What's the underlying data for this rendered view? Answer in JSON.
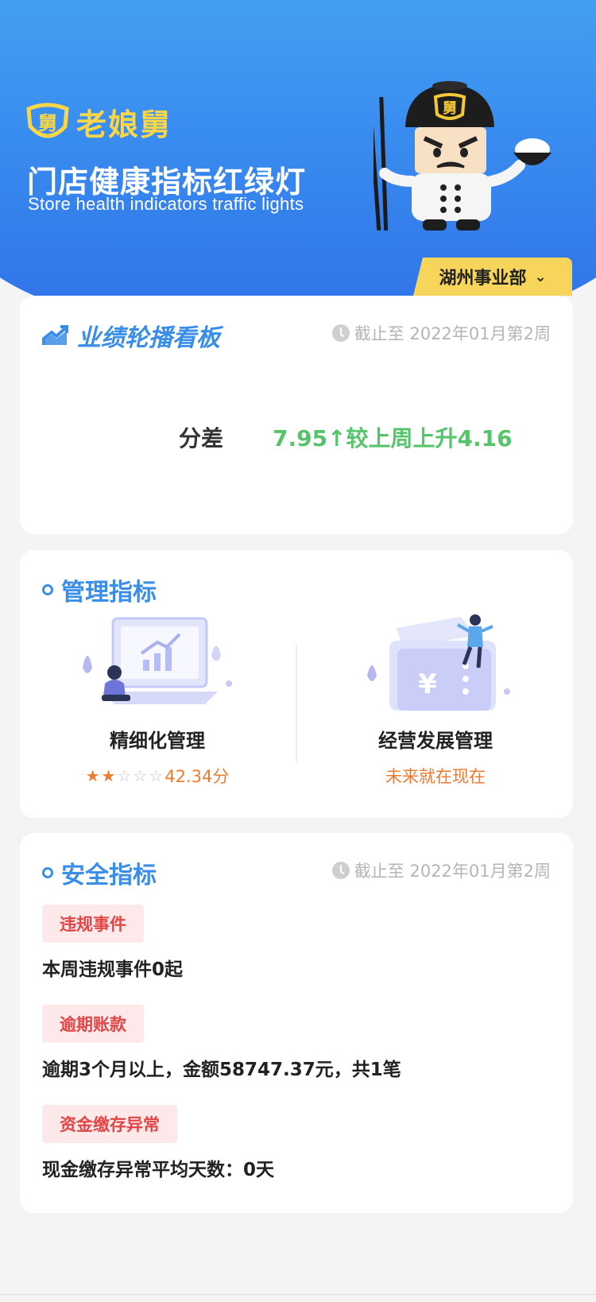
{
  "header": {
    "logo_text": "老娘舅",
    "logo_badge_text": "舅",
    "title": "门店健康指标红绿灯",
    "subtitle": "Store health indicators traffic lights",
    "department": "湖州事业部"
  },
  "performance": {
    "title": "业绩轮播看板",
    "deadline": "截止至 2022年01月第2周",
    "diff_label": "分差",
    "diff_value": "7.95↑较上周上升4.16"
  },
  "management": {
    "title": "管理指标",
    "items": [
      {
        "name": "精细化管理",
        "rating": 2,
        "max_rating": 5,
        "score": "42.34分"
      },
      {
        "name": "经营发展管理",
        "note": "未来就在现在"
      }
    ]
  },
  "safety": {
    "title": "安全指标",
    "deadline": "截止至 2022年01月第2周",
    "sections": [
      {
        "tag": "违规事件",
        "text": "本周违规事件0起"
      },
      {
        "tag": "逾期账款",
        "text": "逾期3个月以上，金额58747.37元，共1笔"
      },
      {
        "tag": "资金缴存异常",
        "text": "现金缴存异常平均天数：0天"
      }
    ]
  },
  "colors": {
    "brand_blue": "#3a8ee8",
    "brand_yellow": "#f6d55a",
    "positive_green": "#56c46b",
    "accent_orange": "#ee7a2f",
    "alert_red": "#e24545"
  }
}
